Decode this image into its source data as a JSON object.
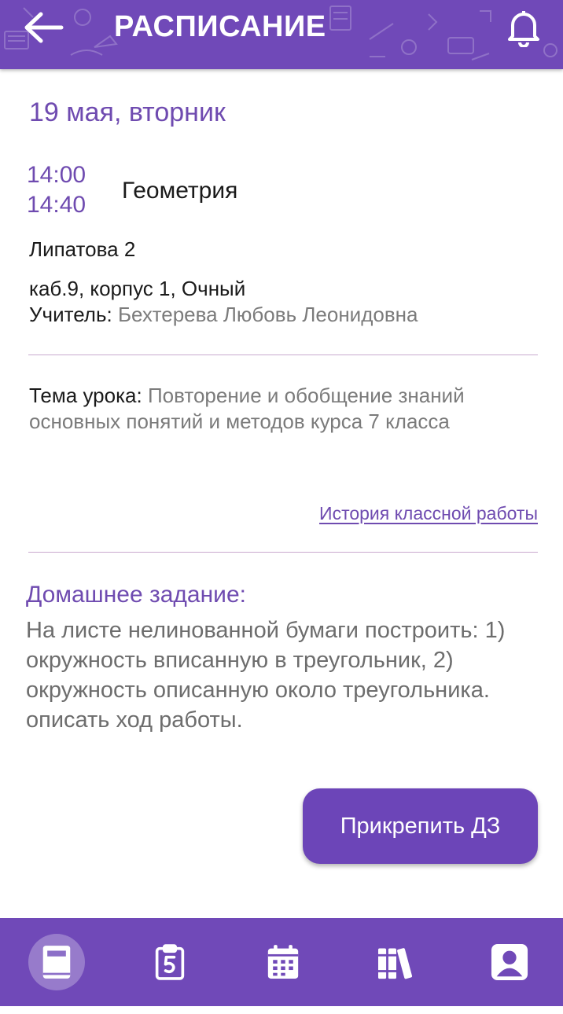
{
  "header": {
    "title": "РАСПИСАНИЕ"
  },
  "lesson": {
    "date": "19 мая, вторник",
    "time_start": "14:00",
    "time_end": "14:40",
    "subject": "Геометрия",
    "group": "Липатова 2",
    "room": "каб.9, корпус 1, Очный",
    "teacher_label": "Учитель:",
    "teacher_name": "Бехтерева Любовь Леонидовна",
    "topic_label": "Тема урока:",
    "topic_text": "Повторение и обобщение знаний основных понятий и методов курса 7 класса",
    "history_link": "История классной работы"
  },
  "homework": {
    "title": "Домашнее задание:",
    "text": "На листе нелинованной бумаги построить: 1) окружность вписанную в треугольник, 2) окружность описанную около треугольника. описать ход работы.",
    "attach_button": "Прикрепить ДЗ"
  },
  "nav": {
    "items": [
      {
        "icon": "diary-book-icon",
        "active": true
      },
      {
        "icon": "grade-clipboard-icon",
        "active": false
      },
      {
        "icon": "calendar-icon",
        "active": false
      },
      {
        "icon": "library-books-icon",
        "active": false
      },
      {
        "icon": "profile-icon",
        "active": false
      }
    ]
  },
  "colors": {
    "brand": "#7049b8",
    "accent_text": "#6f4bb0",
    "divider": "#c9a9cf"
  }
}
